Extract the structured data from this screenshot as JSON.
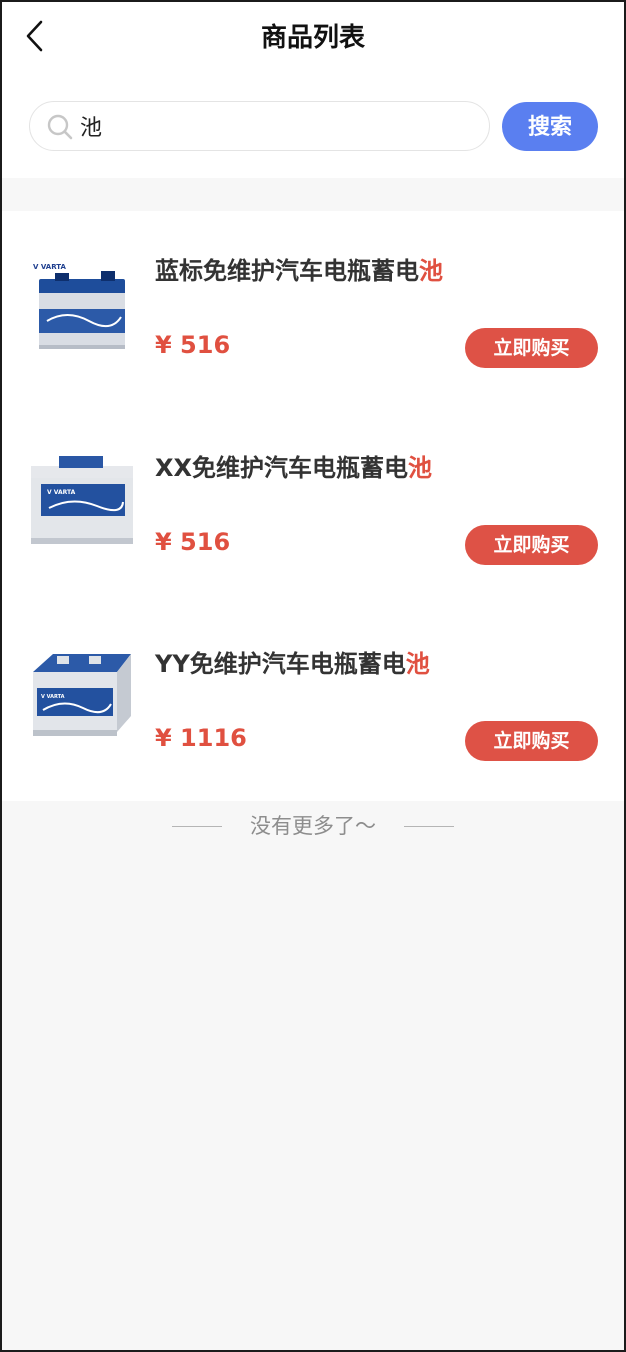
{
  "header": {
    "title": "商品列表",
    "back_icon": "chevron-left-icon"
  },
  "search": {
    "value": "池",
    "placeholder": "",
    "button_label": "搜索",
    "icon": "search-icon",
    "colors": {
      "button": "#5a7ff0"
    }
  },
  "products": [
    {
      "name_prefix": "蓝标免维护汽车电瓶蓄电",
      "name_highlight": "池",
      "price": "¥ 516",
      "buy_label": "立即购买",
      "image_icon": "battery-image"
    },
    {
      "name_prefix": "XX免维护汽车电瓶蓄电",
      "name_highlight": "池",
      "price": "¥ 516",
      "buy_label": "立即购买",
      "image_icon": "battery-image"
    },
    {
      "name_prefix": "YY免维护汽车电瓶蓄电",
      "name_highlight": "池",
      "price": "¥ 1116",
      "buy_label": "立即购买",
      "image_icon": "battery-image"
    }
  ],
  "footer": {
    "end_text": "没有更多了～"
  },
  "colors": {
    "accent_red": "#de5246",
    "price_red": "#e05040",
    "brand_blue": "#5a7ff0"
  }
}
